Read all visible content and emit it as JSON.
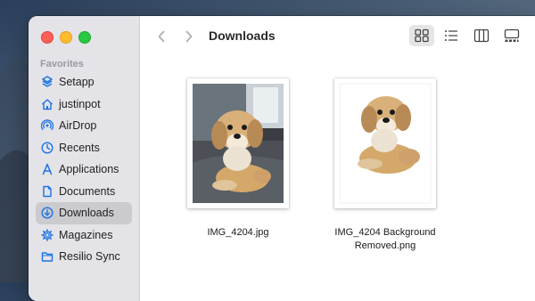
{
  "window": {
    "title": "Downloads"
  },
  "sidebar": {
    "section_title": "Favorites",
    "items": [
      {
        "label": "Setapp",
        "icon": "setapp-icon",
        "selected": false
      },
      {
        "label": "justinpot",
        "icon": "home-icon",
        "selected": false
      },
      {
        "label": "AirDrop",
        "icon": "airdrop-icon",
        "selected": false
      },
      {
        "label": "Recents",
        "icon": "clock-icon",
        "selected": false
      },
      {
        "label": "Applications",
        "icon": "applications-icon",
        "selected": false
      },
      {
        "label": "Documents",
        "icon": "document-icon",
        "selected": false
      },
      {
        "label": "Downloads",
        "icon": "download-icon",
        "selected": true
      },
      {
        "label": "Magazines",
        "icon": "gear-icon",
        "selected": false
      },
      {
        "label": "Resilio Sync",
        "icon": "folder-icon",
        "selected": false
      }
    ]
  },
  "toolbar": {
    "back_icon": "chevron-left-icon",
    "forward_icon": "chevron-right-icon",
    "views": [
      {
        "icon": "icon-view-grid-icon",
        "active": true
      },
      {
        "icon": "list-view-icon",
        "active": false
      },
      {
        "icon": "column-view-icon",
        "active": false
      },
      {
        "icon": "gallery-view-icon",
        "active": false
      }
    ]
  },
  "files": [
    {
      "name": "IMG_4204.jpg",
      "thumbnail": "dog-photo-with-background"
    },
    {
      "name_line1": "IMG_4204 Background",
      "name_line2": "Removed.png",
      "thumbnail": "dog-photo-background-removed"
    }
  ],
  "colors": {
    "accent": "#1a73e8",
    "sidebar_bg": "#e4e3e8",
    "selected_bg": "#cbcacf"
  }
}
